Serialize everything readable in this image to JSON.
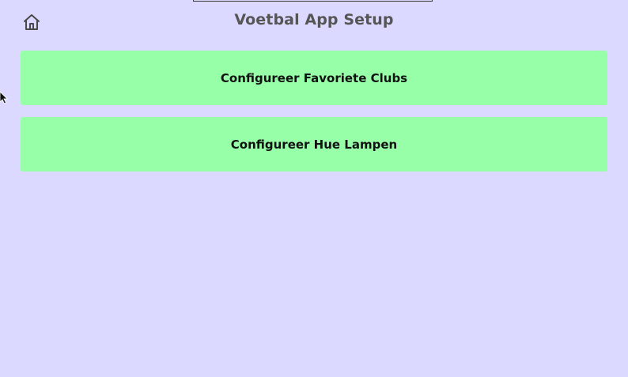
{
  "header": {
    "title": "Voetbal App Setup",
    "home_icon": "home-icon"
  },
  "menu": {
    "items": [
      {
        "label": "Configureer Favoriete Clubs"
      },
      {
        "label": "Configureer Hue Lampen"
      }
    ]
  },
  "colors": {
    "background": "#dbd9ff",
    "button_bg": "#96ffa8",
    "title_text": "#555555",
    "button_text": "#111111"
  }
}
